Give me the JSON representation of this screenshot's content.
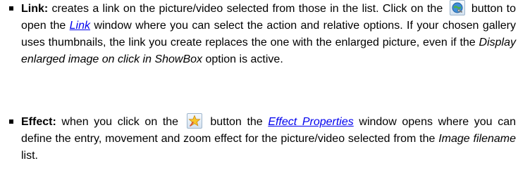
{
  "items": [
    {
      "title": "Link:",
      "t1": " creates a link on the picture/video selected from those in the list. Click on the ",
      "icon": "link-globe-icon",
      "t2": " button to open the ",
      "link_text": "Link",
      "t3": " window where you can select the action and relative options. If your chosen gallery uses thumbnails, the link you create replaces the one with the enlarged picture, even if the ",
      "italic": "Display enlarged image on click in ShowBox",
      "t4": " option is active."
    },
    {
      "title": "Effect:",
      "t1": " when you click on the ",
      "icon": "star-effect-icon",
      "t2": " button the ",
      "link_text": "Effect Properties",
      "t3": " window opens where you can define the entry, movement and zoom effect for the picture/video selected from the ",
      "italic": "Image filename",
      "t4": " list."
    }
  ]
}
